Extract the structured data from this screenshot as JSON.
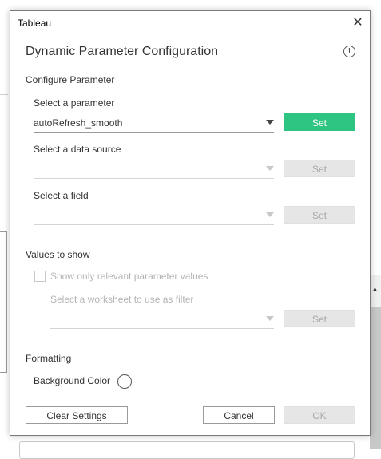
{
  "dialog": {
    "window_title": "Tableau",
    "close_glyph": "✕",
    "heading": "Dynamic Parameter Configuration",
    "info_glyph": "i"
  },
  "configure": {
    "section_label": "Configure Parameter",
    "parameter": {
      "label": "Select a parameter",
      "value": "autoRefresh_smooth",
      "set_label": "Set"
    },
    "data_source": {
      "label": "Select a data source",
      "value": "",
      "set_label": "Set"
    },
    "field": {
      "label": "Select a field",
      "value": "",
      "set_label": "Set"
    }
  },
  "values": {
    "section_label": "Values to show",
    "checkbox_label": "Show only relevant parameter values",
    "checkbox_checked": false,
    "worksheet_label": "Select a worksheet to use as filter",
    "worksheet_value": "",
    "set_label": "Set"
  },
  "formatting": {
    "section_label": "Formatting",
    "background_label": "Background Color",
    "background_color": "#ffffff"
  },
  "footer": {
    "clear_label": "Clear Settings",
    "cancel_label": "Cancel",
    "ok_label": "OK"
  },
  "colors": {
    "accent": "#2ec482",
    "disabled_bg": "#e6e6e6",
    "disabled_text": "#a8a8a8"
  }
}
